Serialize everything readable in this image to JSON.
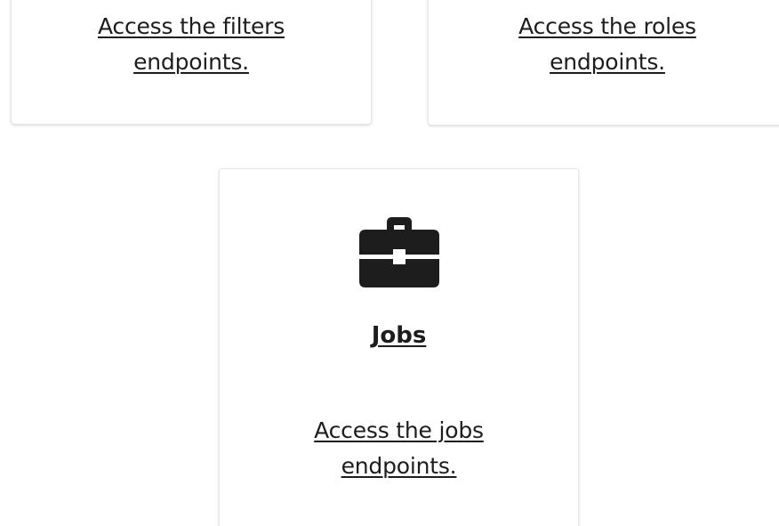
{
  "cards": {
    "filters": {
      "description": "Access the filters endpoints."
    },
    "roles": {
      "description": "Access the roles endpoints."
    },
    "jobs": {
      "icon": "briefcase-icon",
      "title": "Jobs",
      "description": "Access the jobs endpoints."
    }
  },
  "colors": {
    "text": "#1d1d1d",
    "card_border": "#e6e8ec",
    "background": "#ffffff"
  }
}
